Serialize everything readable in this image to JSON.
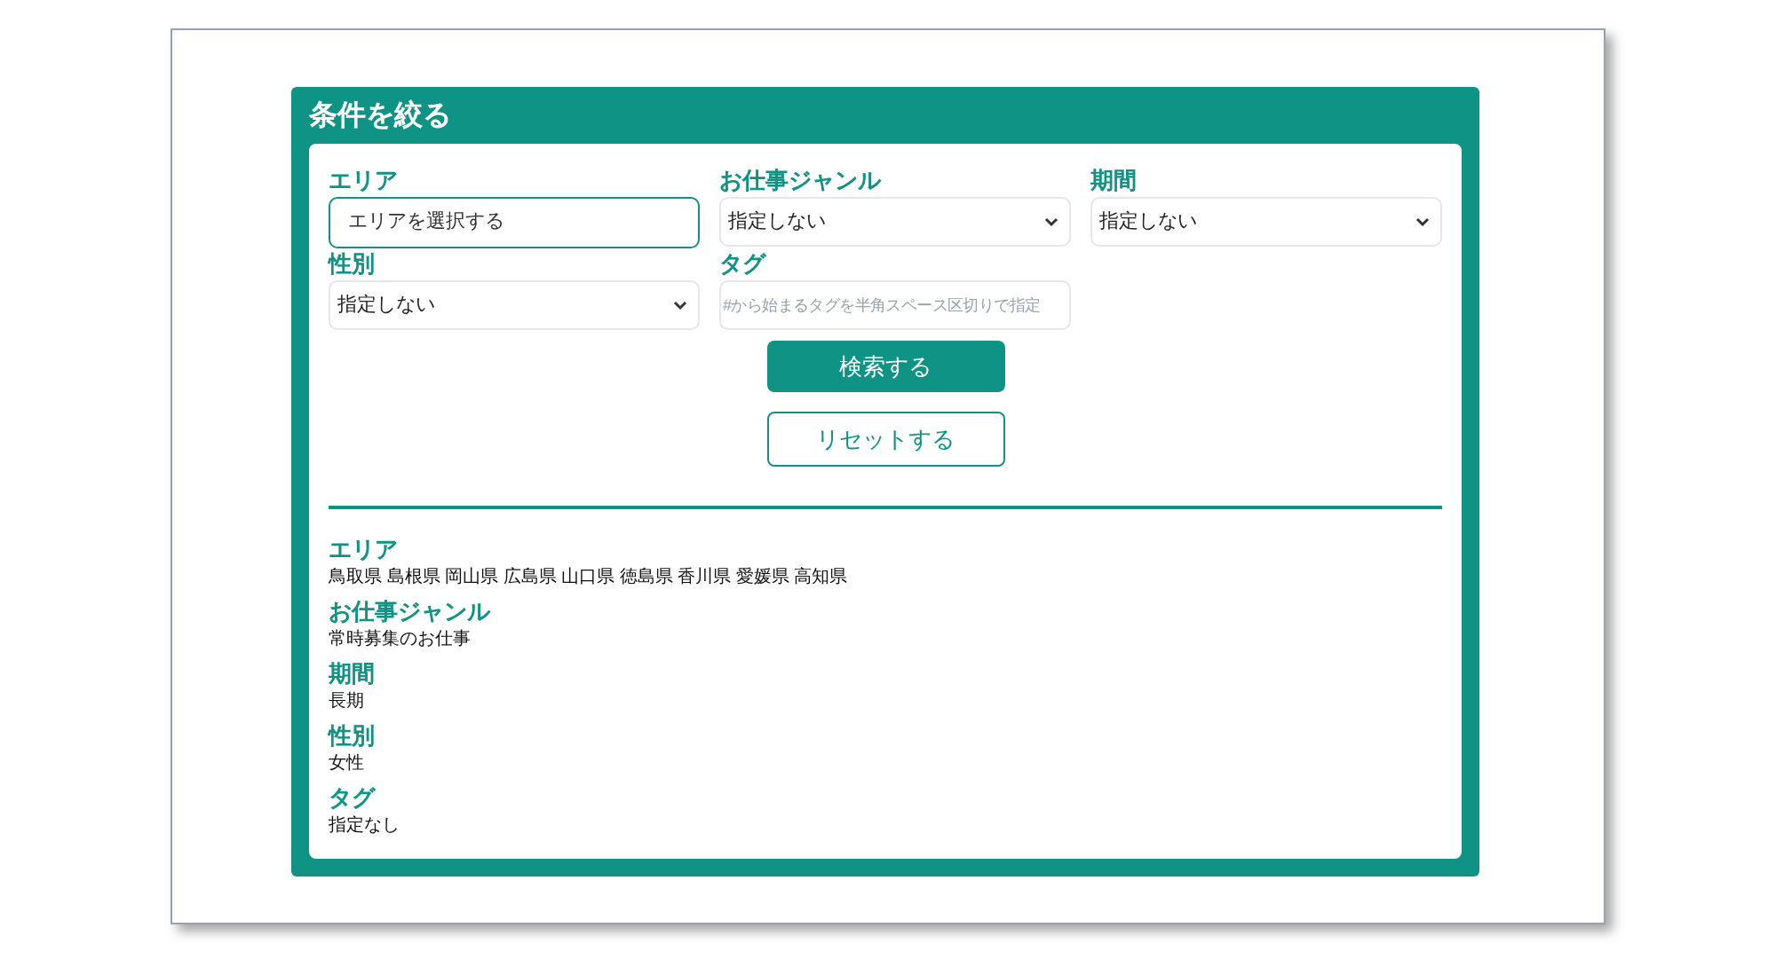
{
  "panel": {
    "title": "条件を絞る"
  },
  "fields": [
    {
      "kind": "picker",
      "label": "エリア",
      "value": "エリアを選択する"
    },
    {
      "kind": "select",
      "label": "お仕事ジャンル",
      "value": "指定しない"
    },
    {
      "kind": "select",
      "label": "期間",
      "value": "指定しない"
    },
    {
      "kind": "select",
      "label": "性別",
      "value": "指定しない"
    },
    {
      "kind": "text",
      "label": "タグ",
      "placeholder": "#から始まるタグを半角スペース区切りで指定"
    }
  ],
  "buttons": [
    {
      "kind": "primary",
      "label": "検索する"
    },
    {
      "kind": "outline",
      "label": "リセットする"
    }
  ],
  "summary": [
    {
      "heading": "エリア",
      "value": "鳥取県 島根県 岡山県 広島県 山口県 徳島県 香川県 愛媛県 高知県"
    },
    {
      "heading": "お仕事ジャンル",
      "value": "常時募集のお仕事"
    },
    {
      "heading": "期間",
      "value": "長期"
    },
    {
      "heading": "性別",
      "value": "女性"
    },
    {
      "heading": "タグ",
      "value": "指定なし"
    }
  ]
}
